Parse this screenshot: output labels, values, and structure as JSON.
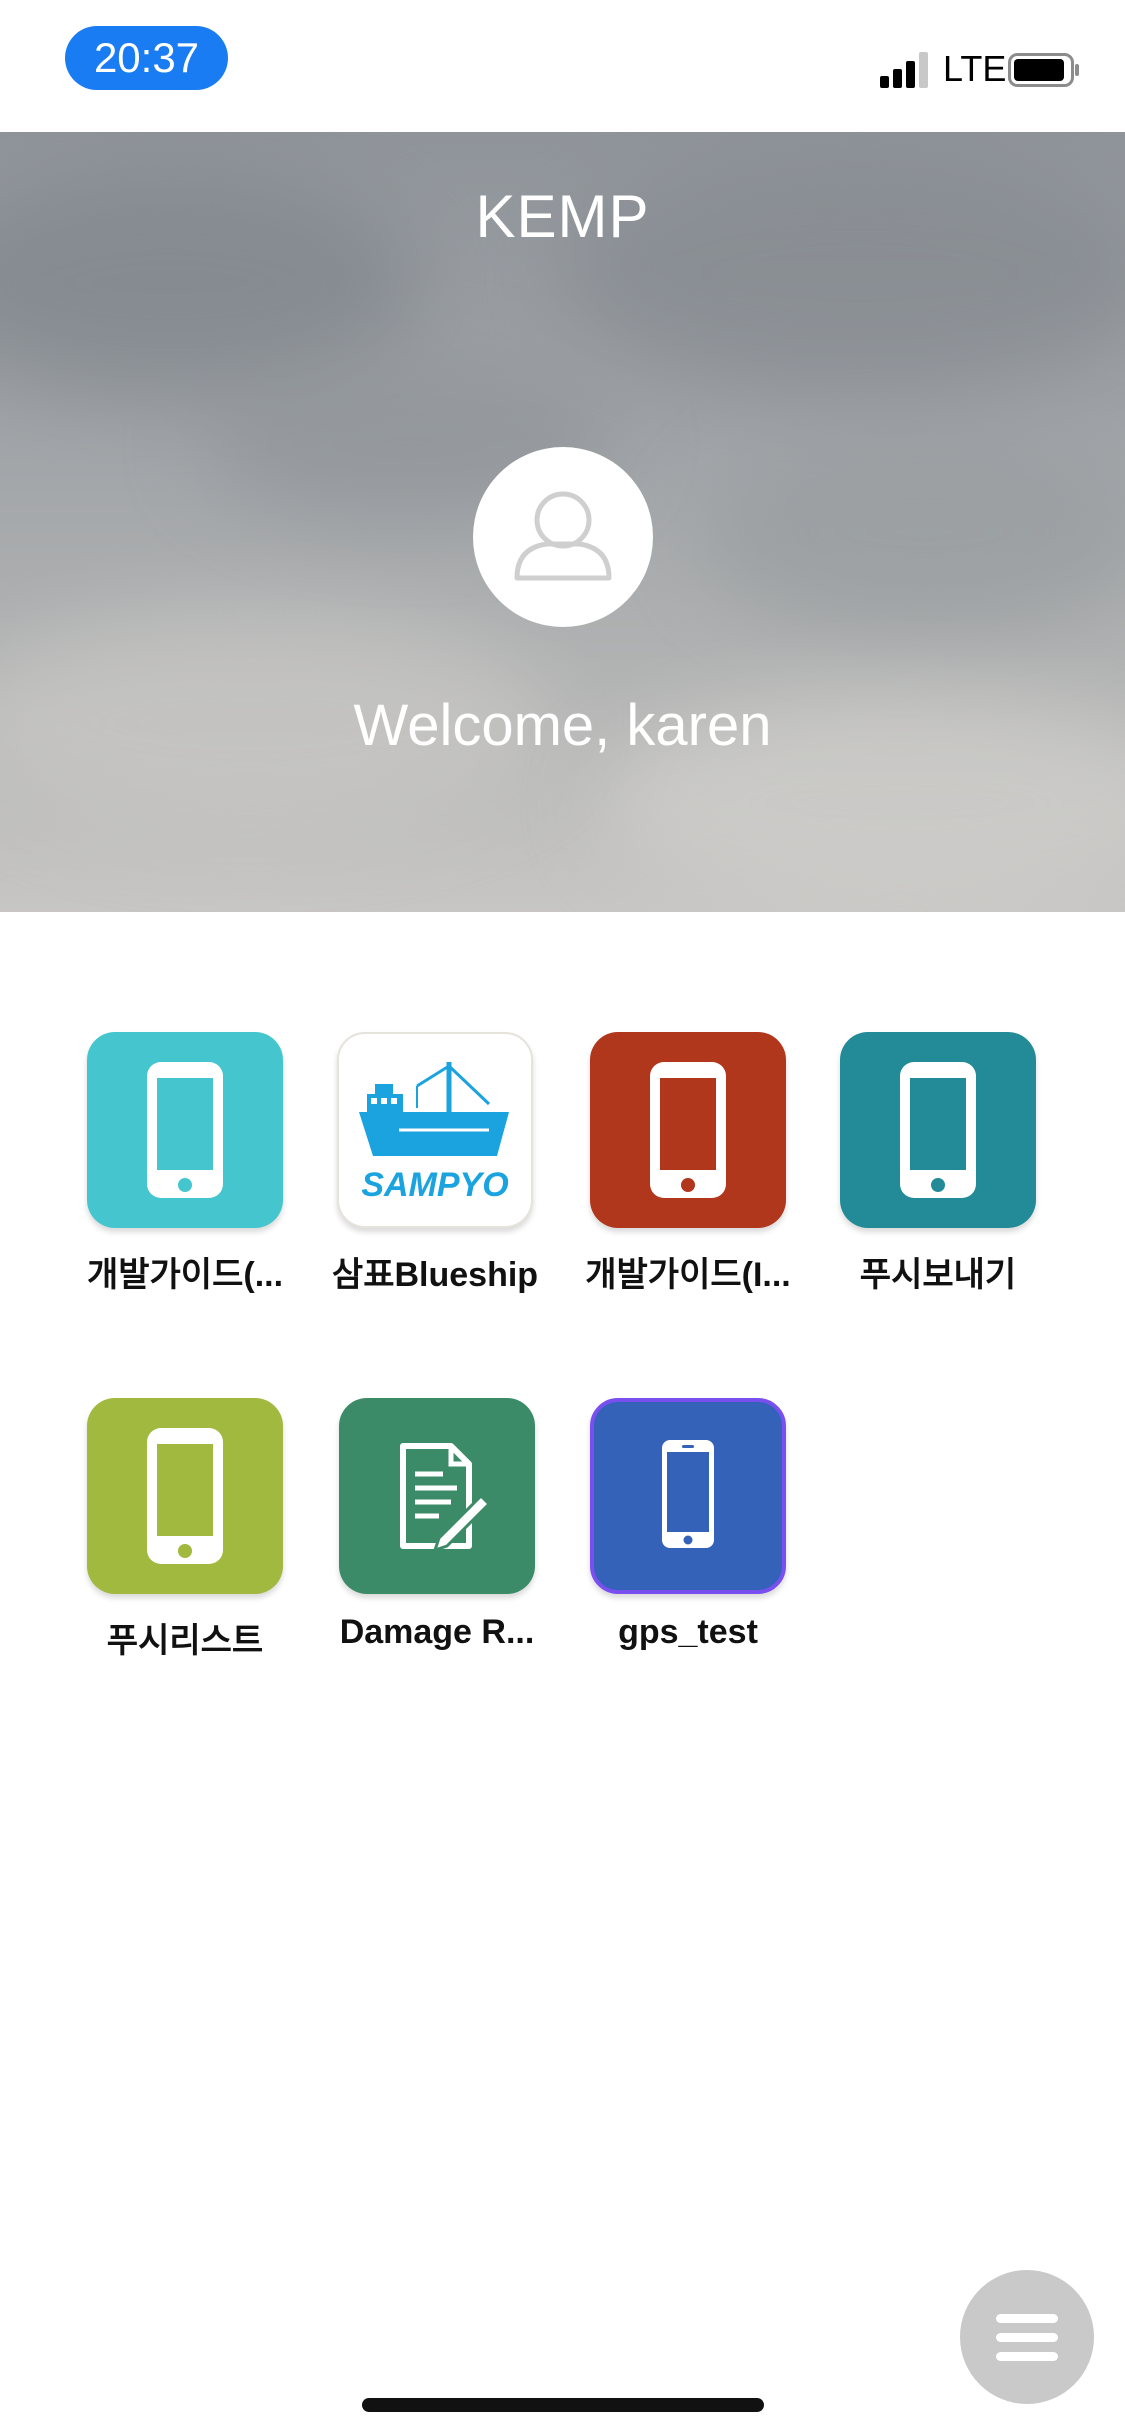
{
  "status_bar": {
    "time": "20:37",
    "network": "LTE",
    "icons": [
      "signal-icon",
      "battery-icon"
    ]
  },
  "header": {
    "title": "KEMP",
    "welcome": "Welcome, karen"
  },
  "apps": [
    {
      "label": "개발가이드(...",
      "icon": "phone-icon",
      "color": "#45c6cf"
    },
    {
      "label": "삼표Blueship",
      "icon": "sampyo-ship-logo",
      "logo_text": "SAMPYO",
      "color": "#ffffff"
    },
    {
      "label": "개발가이드(I...",
      "icon": "phone-icon",
      "color": "#b0361c"
    },
    {
      "label": "푸시보내기",
      "icon": "phone-icon",
      "color": "#238a97"
    },
    {
      "label": "푸시리스트",
      "icon": "phone-icon",
      "color": "#a0b93e"
    },
    {
      "label": "Damage R...",
      "icon": "document-edit-icon",
      "color": "#3c8b68"
    },
    {
      "label": "gps_test",
      "icon": "phone-icon",
      "color": "#3462b8",
      "border": "#7a4ff0"
    }
  ],
  "fab": {
    "icon": "menu-icon"
  }
}
